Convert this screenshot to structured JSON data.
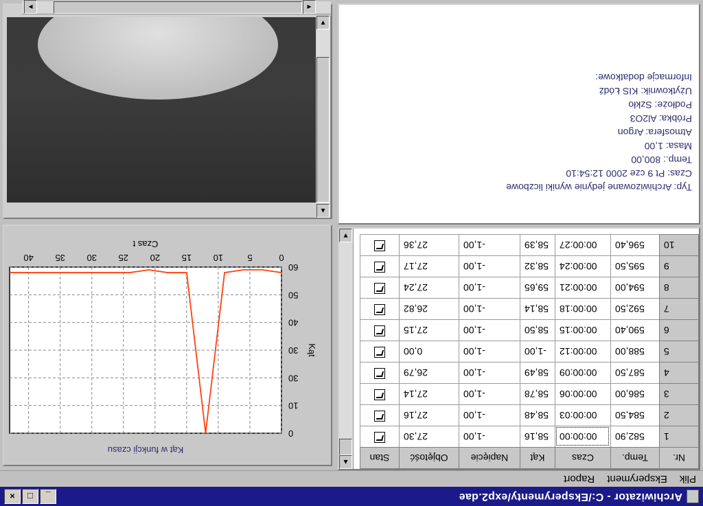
{
  "window": {
    "title": "Archiwizator - C:/Eksperymenty/exp2.dae"
  },
  "menu": [
    "Plik",
    "Eksperyment",
    "Raport"
  ],
  "table": {
    "columns": [
      "Nr.",
      "Temp.",
      "Czas",
      "Kąt",
      "Napięcie",
      "Objętość",
      "Stan"
    ],
    "rows": [
      {
        "nr": "1",
        "temp": "582,90",
        "czas": "00:00:00",
        "kat": "58,16",
        "napiecie": "-1,00",
        "objetosc": "27,30"
      },
      {
        "nr": "2",
        "temp": "584,50",
        "czas": "00:00:03",
        "kat": "58,48",
        "napiecie": "-1,00",
        "objetosc": "27,16"
      },
      {
        "nr": "3",
        "temp": "586,00",
        "czas": "00:00:06",
        "kat": "58,78",
        "napiecie": "-1,00",
        "objetosc": "27,14"
      },
      {
        "nr": "4",
        "temp": "587,50",
        "czas": "00:00:09",
        "kat": "58,49",
        "napiecie": "-1,00",
        "objetosc": "26,79"
      },
      {
        "nr": "5",
        "temp": "588,00",
        "czas": "00:00:12",
        "kat": "-1,00",
        "napiecie": "-1,00",
        "objetosc": "0,00"
      },
      {
        "nr": "6",
        "temp": "590,40",
        "czas": "00:00:15",
        "kat": "58,50",
        "napiecie": "-1,00",
        "objetosc": "27,15"
      },
      {
        "nr": "7",
        "temp": "592,50",
        "czas": "00:00:18",
        "kat": "58,14",
        "napiecie": "-1,00",
        "objetosc": "26,82"
      },
      {
        "nr": "8",
        "temp": "594,00",
        "czas": "00:00:21",
        "kat": "59,65",
        "napiecie": "-1,00",
        "objetosc": "27,24"
      },
      {
        "nr": "9",
        "temp": "595,50",
        "czas": "00:00:24",
        "kat": "58,32",
        "napiecie": "-1,00",
        "objetosc": "27,17"
      },
      {
        "nr": "10",
        "temp": "596,40",
        "czas": "00:00:27",
        "kat": "58,39",
        "napiecie": "-1,00",
        "objetosc": "27,36"
      }
    ]
  },
  "info": {
    "lines": [
      "Typ:  Archiwizowane jedynie wyniki liczbowe",
      "Czas:  Pt 9 cze 2000  12:54:10",
      "Temp.:  800,00",
      "Masa:  1,00",
      "Atmosfera:  Argon",
      "Próbka:  Al2O3",
      "Podłoże:  Szkło",
      "Użytkownik:  KIS Łódź",
      "Informacje dodatkowe:"
    ]
  },
  "chart_data": {
    "type": "line",
    "title": "Czas t",
    "xlabel": "Kąt w funkcji czasu",
    "ylabel": "Kąt",
    "x_ticks": [
      0,
      5,
      10,
      15,
      20,
      25,
      30,
      35,
      40
    ],
    "y_ticks": [
      0,
      10,
      30,
      30,
      40,
      50,
      60
    ],
    "y_tick_labels": [
      "0",
      "10",
      "30",
      "30",
      "40",
      "50",
      "60"
    ],
    "xlim": [
      0,
      43
    ],
    "ylim": [
      0,
      60
    ],
    "grid": true,
    "series": [
      {
        "x": [
          0,
          3,
          6,
          9,
          12,
          15,
          18,
          21,
          24,
          27,
          30,
          33,
          36,
          39,
          43
        ],
        "y": [
          58,
          59,
          59,
          58,
          0,
          58,
          58,
          59,
          58,
          58,
          58,
          58,
          58,
          58,
          58
        ],
        "color": "#ff4010"
      }
    ]
  },
  "colors": {
    "titlebar": "#1a1a8a",
    "series": "#ff4010",
    "info_text": "#2c2c70"
  },
  "scroll": {
    "arrow_up": "▲",
    "arrow_down": "▼",
    "arrow_left": "◄",
    "arrow_right": "►"
  }
}
